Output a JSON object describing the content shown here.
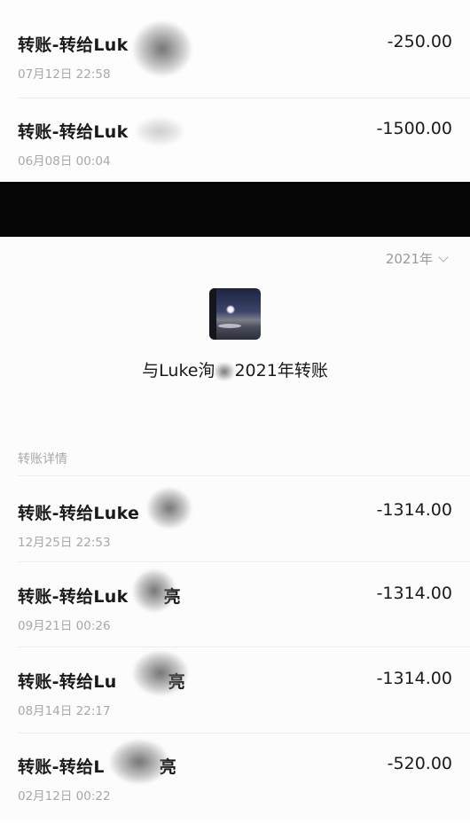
{
  "top_transactions": [
    {
      "title": "转账-转给Luk",
      "date": "07月12日 22:58",
      "amount": "-250.00"
    },
    {
      "title": "转账-转给Luk",
      "date": "06月08日 00:04",
      "amount": "-1500.00"
    }
  ],
  "year_picker": {
    "label": "2021年",
    "icon": "chevron-down-icon"
  },
  "contact": {
    "title_prefix": "与Luke洵",
    "title_suffix": "2021年转账",
    "avatar": "moon-over-lake-photo"
  },
  "section_label": "转账详情",
  "transactions": [
    {
      "title": "转账-转给Luke",
      "date": "12月25日 22:53",
      "amount": "-1314.00"
    },
    {
      "title": "转账-转给Luk",
      "title_tail": "亮",
      "date": "09月21日 00:26",
      "amount": "-1314.00"
    },
    {
      "title": "转账-转给Lu",
      "title_tail": "亮",
      "date": "08月14日 22:17",
      "amount": "-1314.00"
    },
    {
      "title": "转账-转给L",
      "title_tail": "亮",
      "date": "02月12日 00:22",
      "amount": "-520.00"
    }
  ]
}
